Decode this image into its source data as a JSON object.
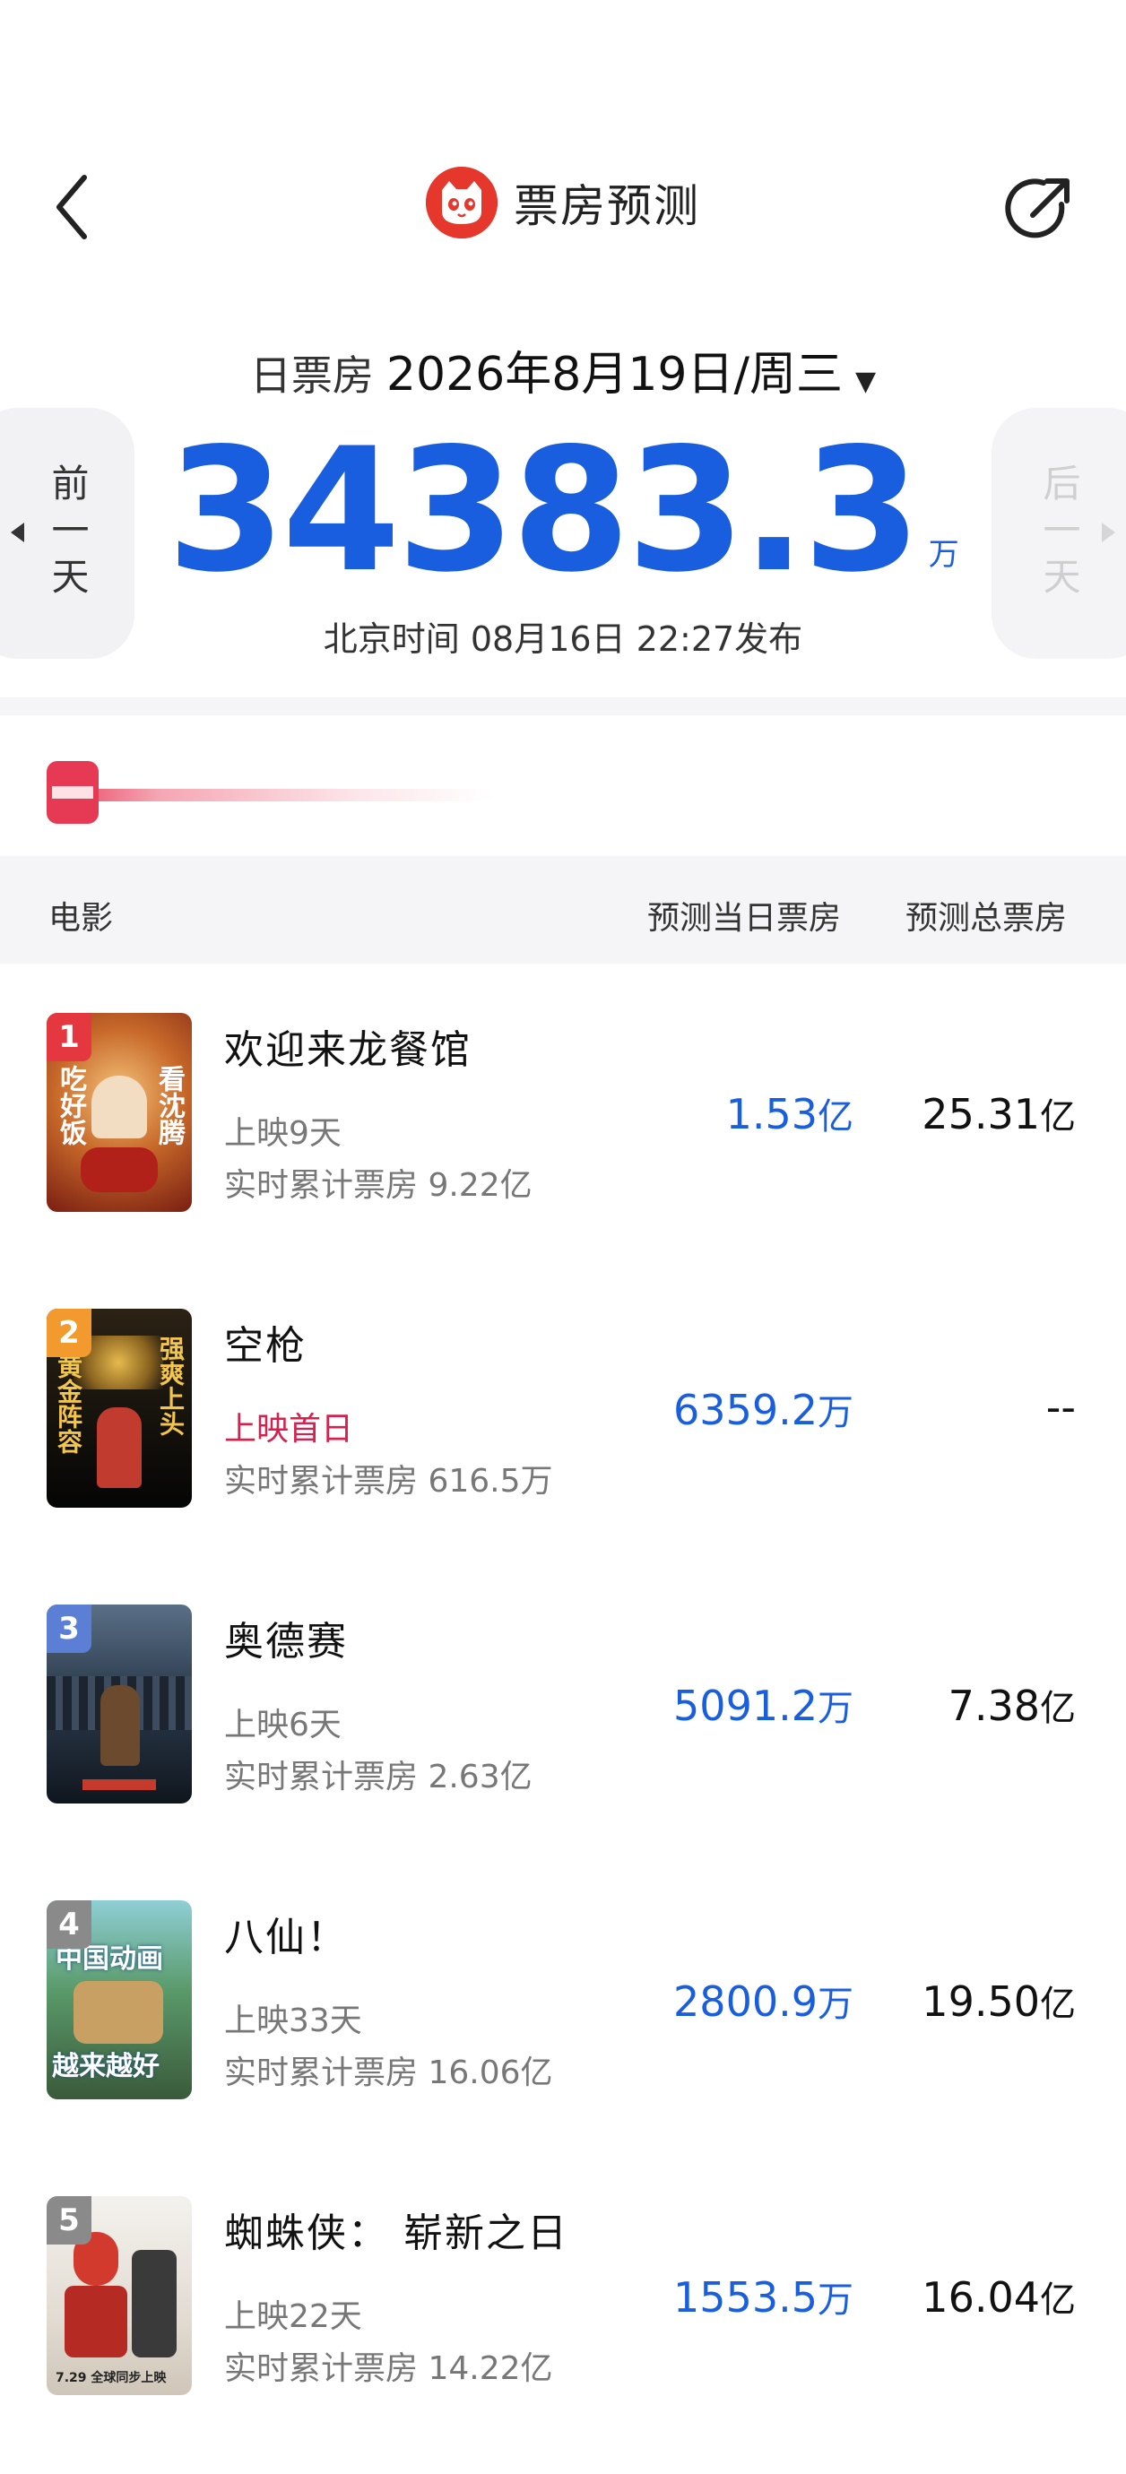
{
  "header": {
    "title": "票房预测",
    "back_icon": "chevron-left-icon",
    "share_icon": "share-icon",
    "logo_icon": "cat-logo-icon",
    "brand_color": "#e5372b"
  },
  "date_selector": {
    "label": "日票房",
    "value": "2026年8月19日/周三",
    "caret": "▼"
  },
  "nav": {
    "prev_label": "前一天",
    "next_label": "后一天"
  },
  "summary": {
    "total": "34383.3",
    "unit": "万",
    "publish_time": "北京时间  08月16日  22:27发布",
    "accent_color": "#1a5ee0"
  },
  "table": {
    "col_movie": "电影",
    "col_day": "预测当日票房",
    "col_total": "预测总票房"
  },
  "movies": [
    {
      "rank": "1",
      "title": "欢迎来龙餐馆",
      "status": "上映9天",
      "realtime": "实时累计票房 9.22亿",
      "day_num": "1.53",
      "day_unit": "亿",
      "total_num": "25.31",
      "total_unit": "亿",
      "poster_text_left": "吃好饭",
      "poster_text_right": "看沈腾"
    },
    {
      "rank": "2",
      "title": "空枪",
      "status": "上映首日",
      "realtime": "实时累计票房 616.5万",
      "day_num": "6359.2",
      "day_unit": "万",
      "total_num": "--",
      "total_unit": "",
      "poster_text_left": "黄金阵容",
      "poster_text_right": "强爽上头"
    },
    {
      "rank": "3",
      "title": "奥德赛",
      "status": "上映6天",
      "realtime": "实时累计票房 2.63亿",
      "day_num": "5091.2",
      "day_unit": "万",
      "total_num": "7.38",
      "total_unit": "亿"
    },
    {
      "rank": "4",
      "title": "八仙！",
      "status": "上映33天",
      "realtime": "实时累计票房 16.06亿",
      "day_num": "2800.9",
      "day_unit": "万",
      "total_num": "19.50",
      "total_unit": "亿",
      "poster_text_top": "中国动画",
      "poster_text_bottom": "越来越好"
    },
    {
      "rank": "5",
      "title": "蜘蛛侠： 崭新之日",
      "status": "上映22天",
      "realtime": "实时累计票房 14.22亿",
      "day_num": "1553.5",
      "day_unit": "万",
      "total_num": "16.04",
      "total_unit": "亿",
      "poster_caption": "7.29 全球同步上映"
    }
  ]
}
